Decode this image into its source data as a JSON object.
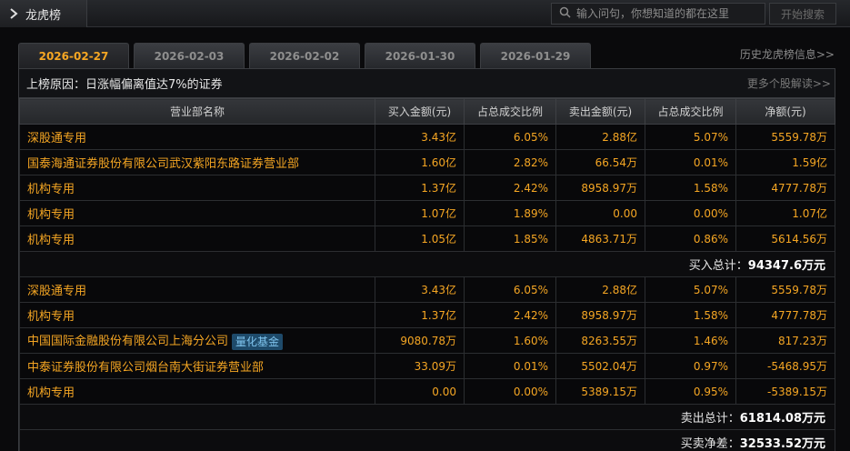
{
  "header": {
    "title": "龙虎榜",
    "search_placeholder": "输入问句，你想知道的都在这里",
    "search_button": "开始搜索"
  },
  "tabs": [
    {
      "label": "2026-02-27",
      "active": true
    },
    {
      "label": "2026-02-03",
      "active": false
    },
    {
      "label": "2026-02-02",
      "active": false
    },
    {
      "label": "2026-01-30",
      "active": false
    },
    {
      "label": "2026-01-29",
      "active": false
    }
  ],
  "history_link": "历史龙虎榜信息>>",
  "reason": {
    "label": "上榜原因：",
    "text": "日涨幅偏离值达7%的证券",
    "more_link": "更多个股解读>>"
  },
  "table": {
    "columns": [
      "营业部名称",
      "买入金额(元)",
      "占总成交比例",
      "卖出金额(元)",
      "占总成交比例",
      "净额(元)"
    ],
    "buy_rows": [
      {
        "name": "深股通专用",
        "badge": "",
        "buy": "3.43亿",
        "buy_pct": "6.05%",
        "sell": "2.88亿",
        "sell_pct": "5.07%",
        "net": "5559.78万"
      },
      {
        "name": "国泰海通证券股份有限公司武汉紫阳东路证券营业部",
        "badge": "",
        "buy": "1.60亿",
        "buy_pct": "2.82%",
        "sell": "66.54万",
        "sell_pct": "0.01%",
        "net": "1.59亿"
      },
      {
        "name": "机构专用",
        "badge": "",
        "buy": "1.37亿",
        "buy_pct": "2.42%",
        "sell": "8958.97万",
        "sell_pct": "1.58%",
        "net": "4777.78万"
      },
      {
        "name": "机构专用",
        "badge": "",
        "buy": "1.07亿",
        "buy_pct": "1.89%",
        "sell": "0.00",
        "sell_pct": "0.00%",
        "net": "1.07亿"
      },
      {
        "name": "机构专用",
        "badge": "",
        "buy": "1.05亿",
        "buy_pct": "1.85%",
        "sell": "4863.71万",
        "sell_pct": "0.86%",
        "net": "5614.56万"
      }
    ],
    "buy_total_label": "买入总计：",
    "buy_total_value": "94347.6万元",
    "sell_rows": [
      {
        "name": "深股通专用",
        "badge": "",
        "buy": "3.43亿",
        "buy_pct": "6.05%",
        "sell": "2.88亿",
        "sell_pct": "5.07%",
        "net": "5559.78万"
      },
      {
        "name": "机构专用",
        "badge": "",
        "buy": "1.37亿",
        "buy_pct": "2.42%",
        "sell": "8958.97万",
        "sell_pct": "1.58%",
        "net": "4777.78万"
      },
      {
        "name": "中国国际金融股份有限公司上海分公司",
        "badge": "量化基金",
        "buy": "9080.78万",
        "buy_pct": "1.60%",
        "sell": "8263.55万",
        "sell_pct": "1.46%",
        "net": "817.23万"
      },
      {
        "name": "中泰证券股份有限公司烟台南大街证券营业部",
        "badge": "",
        "buy": "33.09万",
        "buy_pct": "0.01%",
        "sell": "5502.04万",
        "sell_pct": "0.97%",
        "net": "-5468.95万"
      },
      {
        "name": "机构专用",
        "badge": "",
        "buy": "0.00",
        "buy_pct": "0.00%",
        "sell": "5389.15万",
        "sell_pct": "0.95%",
        "net": "-5389.15万"
      }
    ],
    "sell_total_label": "卖出总计：",
    "sell_total_value": "61814.08万元",
    "net_diff_label": "买卖净差：",
    "net_diff_value": "32533.52万元"
  },
  "colors": {
    "accent": "#f5a623",
    "badge_bg": "#1e4a6a",
    "badge_text": "#7fc4ee"
  }
}
